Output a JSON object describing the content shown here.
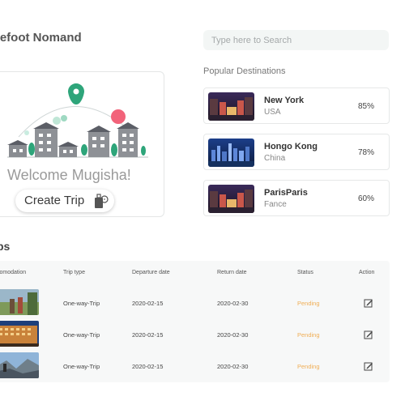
{
  "header": {
    "brand": "refoot Nomand",
    "search_placeholder": "Type here to Search"
  },
  "welcome": {
    "title": "Welcome Mugisha!",
    "create_button": "Create Trip"
  },
  "popular": {
    "title": "Popular Destinations",
    "items": [
      {
        "city": "New York",
        "country": "USA",
        "percent": "85%"
      },
      {
        "city": "Hongo Kong",
        "country": "China",
        "percent": "78%"
      },
      {
        "city": "ParisParis",
        "country": "Fance",
        "percent": "60%"
      }
    ]
  },
  "trips": {
    "title": "ps",
    "headers": {
      "accommodation": "comodation",
      "trip_type": "Trip type",
      "departure": "Departure date",
      "return": "Return date",
      "status": "Status",
      "action": "Action"
    },
    "rows": [
      {
        "trip_type": "One-way-Trip",
        "departure": "2020-02-15",
        "return": "2020-02-30",
        "status": "Pending"
      },
      {
        "trip_type": "One-way-Trip",
        "departure": "2020-02-15",
        "return": "2020-02-30",
        "status": "Pending"
      },
      {
        "trip_type": "One-way-Trip",
        "departure": "2020-02-15",
        "return": "2020-02-30",
        "status": "Pending"
      }
    ]
  },
  "colors": {
    "pending": "#f0ae56",
    "illustration_green": "#2ea57a",
    "illustration_pink": "#f2637a"
  },
  "icons": [
    "search-icon",
    "location-pin-icon",
    "luggage-icon",
    "edit-icon"
  ]
}
